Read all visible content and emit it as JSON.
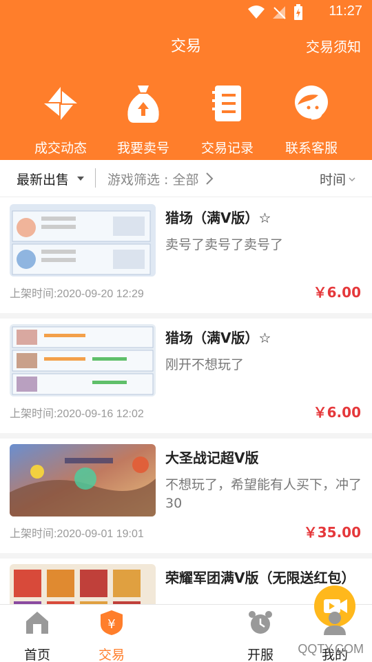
{
  "status_bar": {
    "time": "11:27"
  },
  "header": {
    "title": "交易",
    "notice_link": "交易须知"
  },
  "quick_actions": [
    {
      "label": "成交动态",
      "icon": "pinwheel-icon"
    },
    {
      "label": "我要卖号",
      "icon": "money-bag-icon"
    },
    {
      "label": "交易记录",
      "icon": "record-book-icon"
    },
    {
      "label": "联系客服",
      "icon": "customer-service-icon"
    }
  ],
  "filters": {
    "latest": "最新出售",
    "game_filter": "游戏筛选 : 全部",
    "sort": "时间"
  },
  "listings": [
    {
      "title": "猎场（满V版）☆",
      "desc": "卖号了卖号了卖号了",
      "date": "上架时间:2020-09-20 12:29",
      "price": "￥6.00"
    },
    {
      "title": "猎场（满V版）☆",
      "desc": "刚开不想玩了",
      "date": "上架时间:2020-09-16 12:02",
      "price": "￥6.00"
    },
    {
      "title": "大圣战记超V版",
      "desc": "不想玩了，希望能有人买下，冲了30",
      "date": "上架时间:2020-09-01 19:01",
      "price": "￥35.00"
    },
    {
      "title": "荣耀军团满V版（无限送红包）",
      "desc": "",
      "date": "",
      "price": ""
    }
  ],
  "tabs": [
    {
      "label": "首页",
      "icon": "home-icon"
    },
    {
      "label": "交易",
      "icon": "trade-shield-icon"
    },
    {
      "label": "",
      "icon": "video-icon"
    },
    {
      "label": "开服",
      "icon": "alarm-clock-icon"
    },
    {
      "label": "我的",
      "icon": "user-icon"
    }
  ],
  "watermark": "QQTY.COM",
  "colors": {
    "brand": "#FF7E2B",
    "price": "#E5383B",
    "live": "#FFB81C"
  }
}
